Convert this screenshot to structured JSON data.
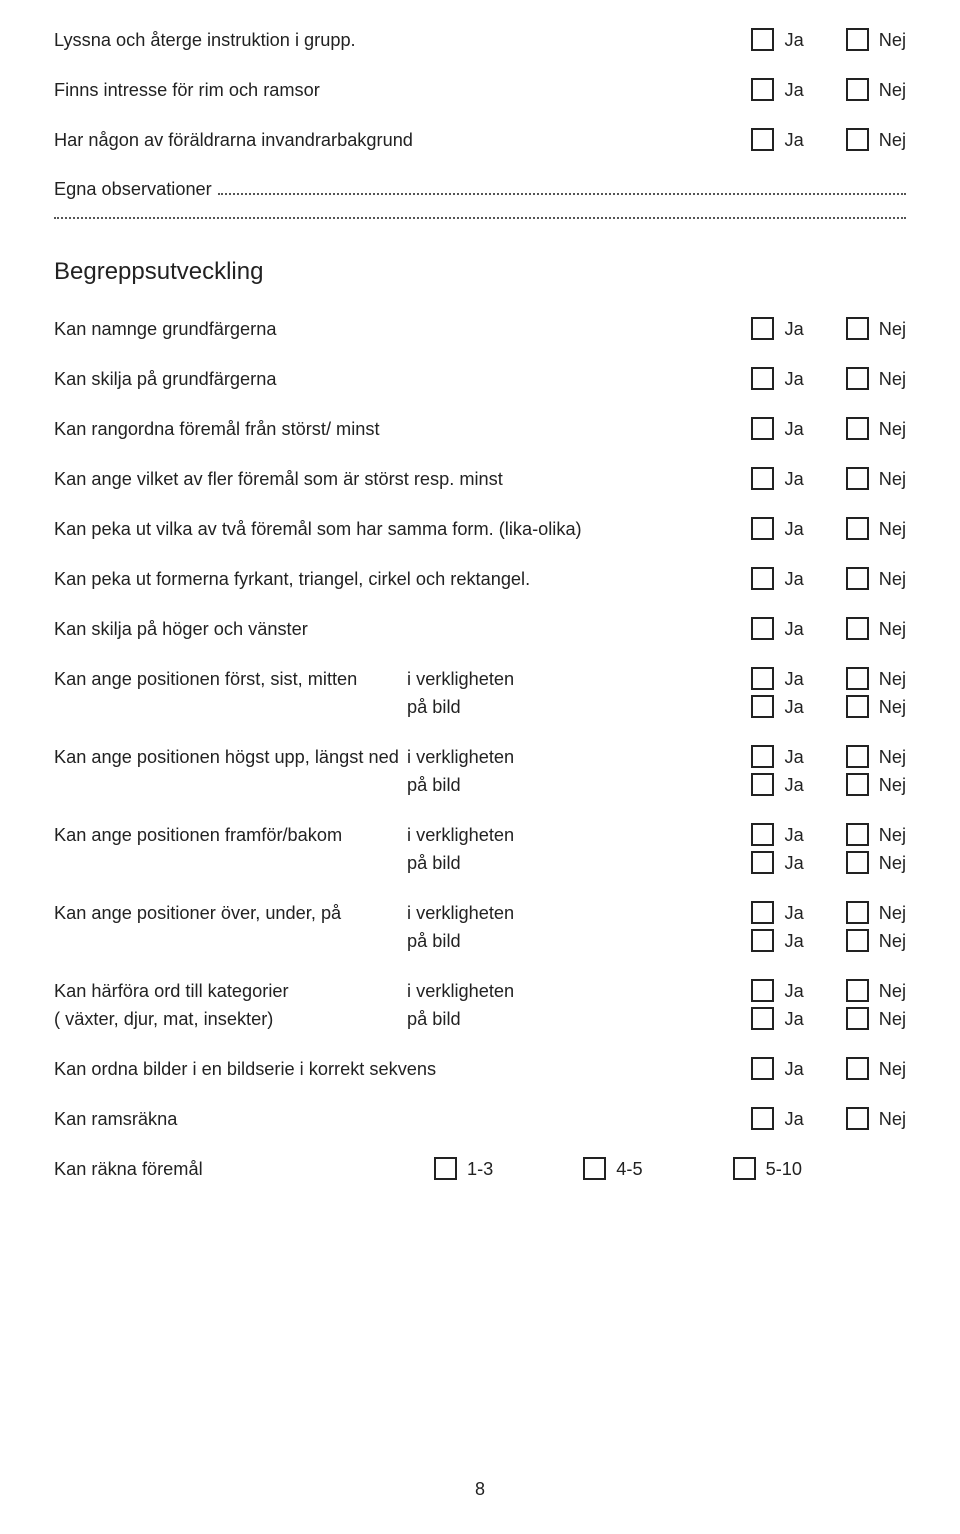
{
  "labels": {
    "yes": "Ja",
    "no": "Nej"
  },
  "obs": {
    "title": "Egna observationer",
    "dots1_width": 706,
    "dots2_width": 860
  },
  "section_title": "Begreppsutveckling",
  "top_items": [
    "Lyssna och återge instruktion i grupp.",
    "Finns intresse för rim och ramsor",
    "Har någon av föräldrarna invandrarbakgrund"
  ],
  "mid_items": [
    "Kan namnge grundfärgerna",
    "Kan skilja på grundfärgerna",
    "Kan rangordna föremål från störst/ minst",
    "Kan ange vilket av fler föremål som är störst resp. minst",
    "Kan peka ut vilka av två föremål som har samma form. (lika-olika)",
    "Kan peka ut formerna fyrkant, triangel, cirkel och rektangel.",
    "Kan skilja på höger och vänster"
  ],
  "pair_items": [
    {
      "main": "Kan ange positionen först, sist, mitten",
      "sub1": "i verkligheten",
      "sub2": "på bild",
      "note": ""
    },
    {
      "main": "Kan ange positionen högst upp, längst ned",
      "sub1": "i verkligheten",
      "sub2": "på bild",
      "note": ""
    },
    {
      "main": "Kan ange positionen framför/bakom",
      "sub1": "i verkligheten",
      "sub2": "på  bild",
      "note": ""
    },
    {
      "main": "Kan ange positioner över, under,  på",
      "sub1": "i verkligheten",
      "sub2": "på bild",
      "note": ""
    },
    {
      "main": "Kan härföra ord till kategorier",
      "sub1": "i verkligheten",
      "sub2": "på bild",
      "note": "( växter, djur, mat, insekter)"
    }
  ],
  "tail_items": [
    "Kan ordna bilder i en bildserie i korrekt sekvens",
    "Kan ramsräkna"
  ],
  "count_item": {
    "label": "Kan räkna föremål",
    "options": [
      "1-3",
      "4-5",
      "5-10"
    ]
  },
  "page_number": "8"
}
